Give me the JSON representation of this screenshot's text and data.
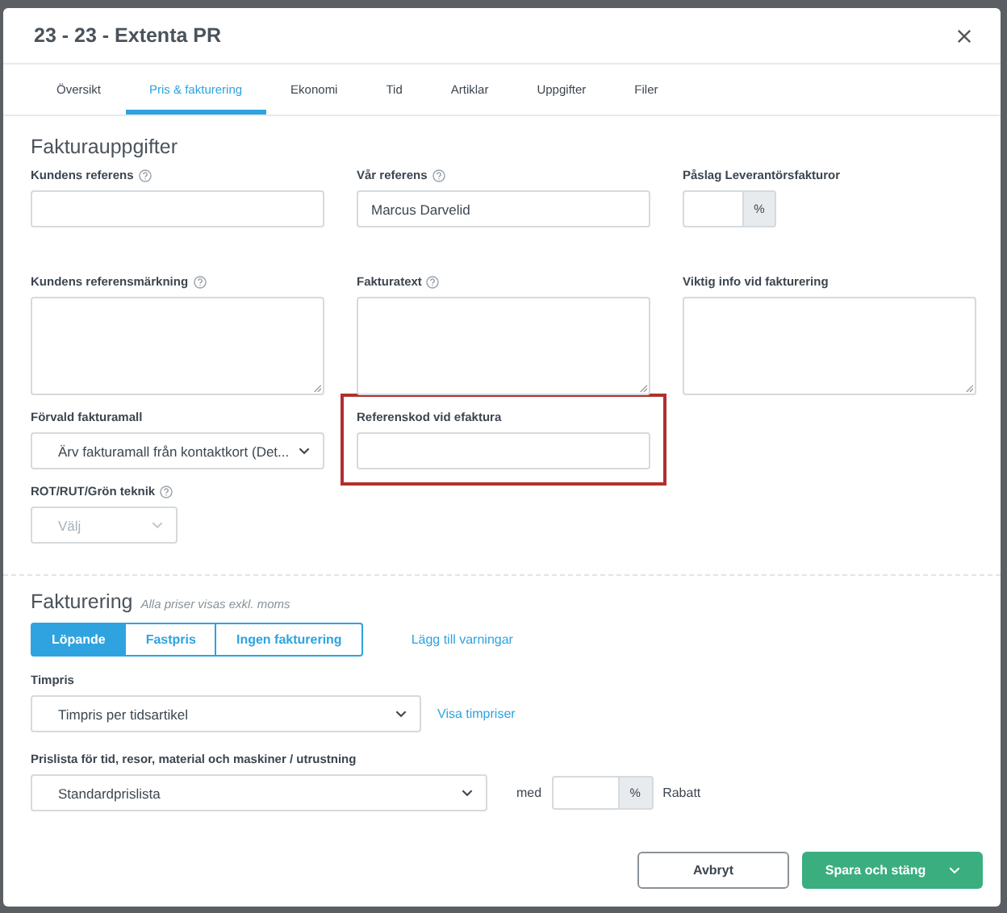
{
  "dialog": {
    "title": "23 - 23 - Extenta PR"
  },
  "tabs": [
    {
      "label": "Översikt",
      "selected": false
    },
    {
      "label": "Pris & fakturering",
      "selected": true
    },
    {
      "label": "Ekonomi",
      "selected": false
    },
    {
      "label": "Tid",
      "selected": false
    },
    {
      "label": "Artiklar",
      "selected": false
    },
    {
      "label": "Uppgifter",
      "selected": false
    },
    {
      "label": "Filer",
      "selected": false
    }
  ],
  "invoice_details": {
    "heading": "Fakturauppgifter",
    "rows": [
      [
        {
          "kind": "text",
          "label": "Kundens referens",
          "help": true
        },
        {
          "kind": "text",
          "label": "Vår referens",
          "help": true,
          "value": "Marcus Darvelid"
        },
        {
          "kind": "percent",
          "label": "Påslag Leverantörsfakturor",
          "help": false,
          "unit": "%"
        }
      ],
      [
        {
          "kind": "textarea",
          "label": "Kundens referensmärkning",
          "help": true
        },
        {
          "kind": "textarea",
          "label": "Fakturatext",
          "help": true
        },
        {
          "kind": "textarea",
          "label": "Viktig info vid fakturering",
          "help": false
        }
      ],
      [
        {
          "kind": "select",
          "label": "Förvald fakturamall",
          "help": false,
          "value": "Ärv fakturamall från kontaktkort (Det..."
        },
        {
          "kind": "text",
          "label": "Referenskod vid efaktura",
          "help": false,
          "highlighted": true
        }
      ],
      [
        {
          "kind": "select",
          "label": "ROT/RUT/Grön teknik",
          "help": true,
          "value": "Välj",
          "disabled": true
        }
      ]
    ]
  },
  "billing": {
    "heading": "Fakturering",
    "note": "Alla priser visas exkl. moms",
    "modes": [
      {
        "label": "Löpande",
        "selected": true
      },
      {
        "label": "Fastpris",
        "selected": false
      },
      {
        "label": "Ingen fakturering",
        "selected": false
      }
    ],
    "warnings_link": "Lägg till varningar",
    "hourly_rate": {
      "label": "Timpris",
      "value": "Timpris per tidsartikel",
      "link": "Visa timpriser"
    },
    "price_list": {
      "label": "Prislista för tid, resor, material och maskiner / utrustning",
      "value": "Standardprislista",
      "with": "med",
      "unit": "%",
      "suffix": "Rabatt"
    }
  },
  "footer": {
    "cancel": "Avbryt",
    "save": "Spara och stäng"
  }
}
